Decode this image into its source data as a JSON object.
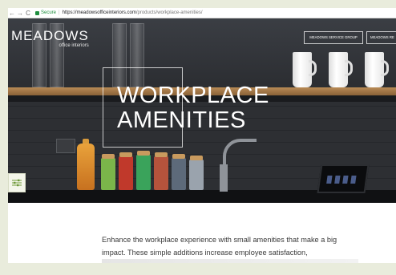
{
  "browser": {
    "back_glyph": "←",
    "forward_glyph": "→",
    "reload_glyph": "C",
    "secure_label": "Secure",
    "separator": "|",
    "url_host": "https://meadowsofficeinteriors.com",
    "url_path": "/products/workplace-amenities/"
  },
  "header": {
    "logo_main": "MEADOWS",
    "logo_sub": "office interiors",
    "nav": [
      "MEADOWS SERVICE GROUP",
      "MEADOWS RE"
    ]
  },
  "hero": {
    "title_line1": "WORKPLACE",
    "title_line2": "AMENITIES"
  },
  "side_button": {
    "icon": "sliders-icon"
  },
  "main": {
    "intro": "Enhance the workplace experience with small amenities that make a big impact. These simple additions increase employee satisfaction,"
  },
  "colors": {
    "background": "#e9ecdc",
    "secure_green": "#1e8e3e",
    "shelf_wood": "#b98b55",
    "text": "#3a3a3a"
  }
}
